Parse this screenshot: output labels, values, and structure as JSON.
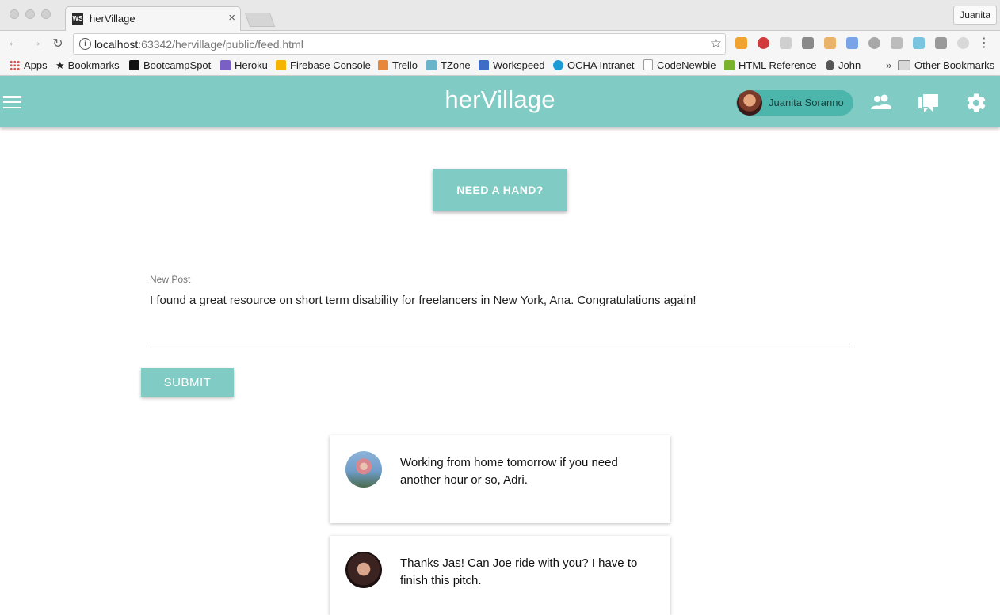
{
  "browser": {
    "tab_title": "herVillage",
    "tab_favicon": "WS",
    "tab_close": "×",
    "profile_name": "Juanita",
    "url_host": "localhost",
    "url_rest": ":63342/hervillage/public/feed.html",
    "bookmarks": [
      {
        "label": "Apps",
        "icon": "apps-grid-icon"
      },
      {
        "label": "Bookmarks",
        "icon": "star-icon"
      },
      {
        "label": "BootcampSpot",
        "icon": "bootcampspot-icon",
        "color": "#111111"
      },
      {
        "label": "Heroku",
        "icon": "heroku-icon",
        "color": "#7a5fc4"
      },
      {
        "label": "Firebase Console",
        "icon": "firebase-icon",
        "color": "#f5b400"
      },
      {
        "label": "Trello",
        "icon": "trello-icon",
        "color": "#e8863a"
      },
      {
        "label": "TZone",
        "icon": "slack-icon",
        "color": "#6ab4c9"
      },
      {
        "label": "Workspeed",
        "icon": "workspeed-icon",
        "color": "#3f6cc7"
      },
      {
        "label": "OCHA Intranet",
        "icon": "ocha-icon",
        "color": "#1b9bd6"
      },
      {
        "label": "CodeNewbie",
        "icon": "page-icon",
        "color": "#ffffff"
      },
      {
        "label": "HTML Reference",
        "icon": "html-ref-icon",
        "color": "#7ab32e"
      },
      {
        "label": "John",
        "icon": "apple-icon",
        "color": "#555555"
      }
    ],
    "bookmarks_overflow": "»",
    "other_bookmarks": "Other Bookmarks"
  },
  "app": {
    "brand": "herVillage",
    "user_name": "Juanita Soranno",
    "accent": "#80cbc4",
    "accent_dark": "#4db6ac"
  },
  "main": {
    "need_hand_label": "NEED A HAND?",
    "new_post_label": "New Post",
    "new_post_value": "I found a great resource on short term disability for freelancers in New York, Ana. Congratulations again!",
    "submit_label": "SUBMIT"
  },
  "feed": [
    {
      "text": "Working from home tomorrow if you need another hour or so, Adri."
    },
    {
      "text": "Thanks Jas! Can Joe ride with you? I have to finish this pitch."
    }
  ]
}
